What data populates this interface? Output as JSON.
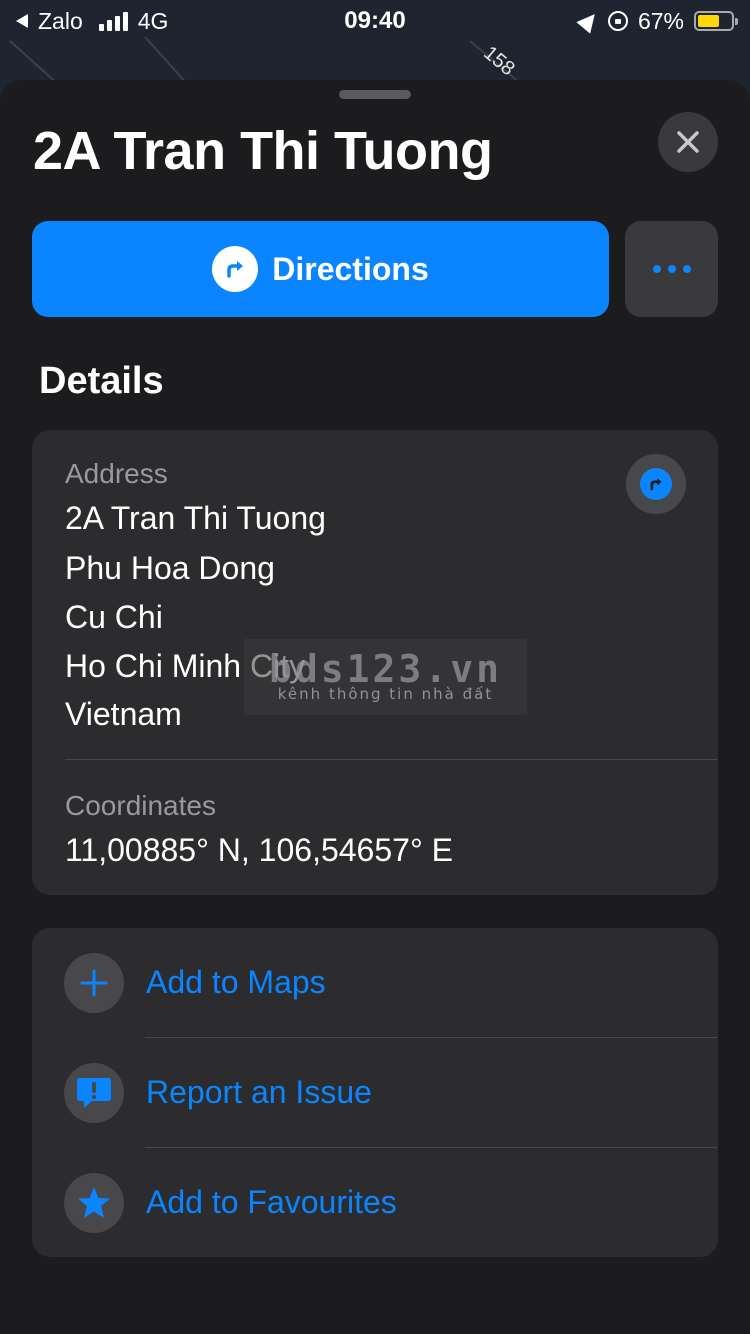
{
  "status_bar": {
    "back_app": "Zalo",
    "network": "4G",
    "time": "09:40",
    "battery": "67%",
    "battery_level": 0.67,
    "battery_color": "#ffd60a"
  },
  "map": {
    "road_label": "158"
  },
  "sheet": {
    "title": "2A Tran Thi Tuong",
    "directions_label": "Directions",
    "details_heading": "Details"
  },
  "details": {
    "address_label": "Address",
    "address_lines": [
      "2A Tran Thi Tuong",
      "Phu Hoa Dong",
      "Cu Chi",
      "Ho Chi Minh City",
      "Vietnam"
    ],
    "coordinates_label": "Coordinates",
    "coordinates_value": "11,00885° N, 106,54657° E"
  },
  "watermark": {
    "main": "bds123.vn",
    "sub": "kênh thông tin nhà đất"
  },
  "actions": [
    {
      "label": "Add to Maps",
      "icon": "plus-icon"
    },
    {
      "label": "Report an Issue",
      "icon": "report-issue-icon"
    },
    {
      "label": "Add to Favourites",
      "icon": "star-icon"
    }
  ],
  "colors": {
    "accent": "#0a84ff",
    "background": "#1c1c1e",
    "card": "#2c2c2e"
  }
}
